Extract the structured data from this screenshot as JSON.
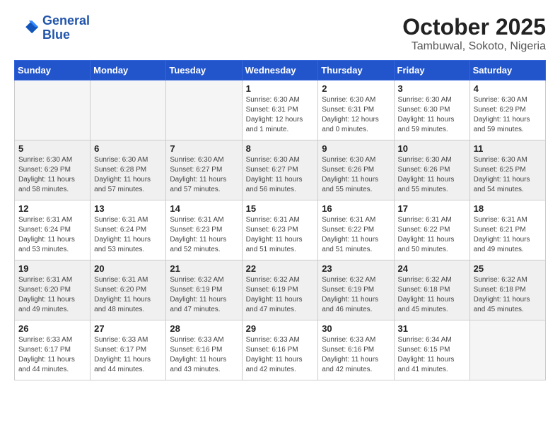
{
  "logo": {
    "line1": "General",
    "line2": "Blue"
  },
  "title": "October 2025",
  "location": "Tambuwal, Sokoto, Nigeria",
  "weekdays": [
    "Sunday",
    "Monday",
    "Tuesday",
    "Wednesday",
    "Thursday",
    "Friday",
    "Saturday"
  ],
  "weeks": [
    [
      {
        "day": "",
        "info": ""
      },
      {
        "day": "",
        "info": ""
      },
      {
        "day": "",
        "info": ""
      },
      {
        "day": "1",
        "info": "Sunrise: 6:30 AM\nSunset: 6:31 PM\nDaylight: 12 hours\nand 1 minute."
      },
      {
        "day": "2",
        "info": "Sunrise: 6:30 AM\nSunset: 6:31 PM\nDaylight: 12 hours\nand 0 minutes."
      },
      {
        "day": "3",
        "info": "Sunrise: 6:30 AM\nSunset: 6:30 PM\nDaylight: 11 hours\nand 59 minutes."
      },
      {
        "day": "4",
        "info": "Sunrise: 6:30 AM\nSunset: 6:29 PM\nDaylight: 11 hours\nand 59 minutes."
      }
    ],
    [
      {
        "day": "5",
        "info": "Sunrise: 6:30 AM\nSunset: 6:29 PM\nDaylight: 11 hours\nand 58 minutes."
      },
      {
        "day": "6",
        "info": "Sunrise: 6:30 AM\nSunset: 6:28 PM\nDaylight: 11 hours\nand 57 minutes."
      },
      {
        "day": "7",
        "info": "Sunrise: 6:30 AM\nSunset: 6:27 PM\nDaylight: 11 hours\nand 57 minutes."
      },
      {
        "day": "8",
        "info": "Sunrise: 6:30 AM\nSunset: 6:27 PM\nDaylight: 11 hours\nand 56 minutes."
      },
      {
        "day": "9",
        "info": "Sunrise: 6:30 AM\nSunset: 6:26 PM\nDaylight: 11 hours\nand 55 minutes."
      },
      {
        "day": "10",
        "info": "Sunrise: 6:30 AM\nSunset: 6:26 PM\nDaylight: 11 hours\nand 55 minutes."
      },
      {
        "day": "11",
        "info": "Sunrise: 6:30 AM\nSunset: 6:25 PM\nDaylight: 11 hours\nand 54 minutes."
      }
    ],
    [
      {
        "day": "12",
        "info": "Sunrise: 6:31 AM\nSunset: 6:24 PM\nDaylight: 11 hours\nand 53 minutes."
      },
      {
        "day": "13",
        "info": "Sunrise: 6:31 AM\nSunset: 6:24 PM\nDaylight: 11 hours\nand 53 minutes."
      },
      {
        "day": "14",
        "info": "Sunrise: 6:31 AM\nSunset: 6:23 PM\nDaylight: 11 hours\nand 52 minutes."
      },
      {
        "day": "15",
        "info": "Sunrise: 6:31 AM\nSunset: 6:23 PM\nDaylight: 11 hours\nand 51 minutes."
      },
      {
        "day": "16",
        "info": "Sunrise: 6:31 AM\nSunset: 6:22 PM\nDaylight: 11 hours\nand 51 minutes."
      },
      {
        "day": "17",
        "info": "Sunrise: 6:31 AM\nSunset: 6:22 PM\nDaylight: 11 hours\nand 50 minutes."
      },
      {
        "day": "18",
        "info": "Sunrise: 6:31 AM\nSunset: 6:21 PM\nDaylight: 11 hours\nand 49 minutes."
      }
    ],
    [
      {
        "day": "19",
        "info": "Sunrise: 6:31 AM\nSunset: 6:20 PM\nDaylight: 11 hours\nand 49 minutes."
      },
      {
        "day": "20",
        "info": "Sunrise: 6:31 AM\nSunset: 6:20 PM\nDaylight: 11 hours\nand 48 minutes."
      },
      {
        "day": "21",
        "info": "Sunrise: 6:32 AM\nSunset: 6:19 PM\nDaylight: 11 hours\nand 47 minutes."
      },
      {
        "day": "22",
        "info": "Sunrise: 6:32 AM\nSunset: 6:19 PM\nDaylight: 11 hours\nand 47 minutes."
      },
      {
        "day": "23",
        "info": "Sunrise: 6:32 AM\nSunset: 6:19 PM\nDaylight: 11 hours\nand 46 minutes."
      },
      {
        "day": "24",
        "info": "Sunrise: 6:32 AM\nSunset: 6:18 PM\nDaylight: 11 hours\nand 45 minutes."
      },
      {
        "day": "25",
        "info": "Sunrise: 6:32 AM\nSunset: 6:18 PM\nDaylight: 11 hours\nand 45 minutes."
      }
    ],
    [
      {
        "day": "26",
        "info": "Sunrise: 6:33 AM\nSunset: 6:17 PM\nDaylight: 11 hours\nand 44 minutes."
      },
      {
        "day": "27",
        "info": "Sunrise: 6:33 AM\nSunset: 6:17 PM\nDaylight: 11 hours\nand 44 minutes."
      },
      {
        "day": "28",
        "info": "Sunrise: 6:33 AM\nSunset: 6:16 PM\nDaylight: 11 hours\nand 43 minutes."
      },
      {
        "day": "29",
        "info": "Sunrise: 6:33 AM\nSunset: 6:16 PM\nDaylight: 11 hours\nand 42 minutes."
      },
      {
        "day": "30",
        "info": "Sunrise: 6:33 AM\nSunset: 6:16 PM\nDaylight: 11 hours\nand 42 minutes."
      },
      {
        "day": "31",
        "info": "Sunrise: 6:34 AM\nSunset: 6:15 PM\nDaylight: 11 hours\nand 41 minutes."
      },
      {
        "day": "",
        "info": ""
      }
    ]
  ]
}
